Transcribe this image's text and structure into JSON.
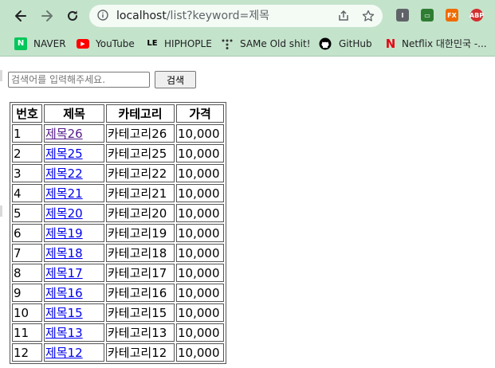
{
  "browser": {
    "url_host": "localhost",
    "url_path": "/list?keyword=제목"
  },
  "bookmarks": [
    {
      "label": "NAVER",
      "icon": "naver-icon",
      "color": "#03c75a"
    },
    {
      "label": "YouTube",
      "icon": "youtube-icon",
      "color": "#ff0000"
    },
    {
      "label": "HIPHOPLE",
      "icon": "hiphople-icon",
      "color": "#000000"
    },
    {
      "label": "SAMe Old shit!",
      "icon": "dots-icon",
      "color": "#333333"
    },
    {
      "label": "GitHub",
      "icon": "github-icon",
      "color": "#000000"
    },
    {
      "label": "Netflix 대한민국 -...",
      "icon": "netflix-icon",
      "color": "#e50914"
    }
  ],
  "search": {
    "placeholder": "검색어를 입력해주세요.",
    "button_label": "검색"
  },
  "table": {
    "headers": [
      "번호",
      "제목",
      "카테고리",
      "가격"
    ],
    "rows": [
      {
        "no": "1",
        "title": "제목26",
        "category": "카테고리26",
        "price": "10,000",
        "visited": true
      },
      {
        "no": "2",
        "title": "제목25",
        "category": "카테고리25",
        "price": "10,000",
        "visited": false
      },
      {
        "no": "3",
        "title": "제목22",
        "category": "카테고리22",
        "price": "10,000",
        "visited": false
      },
      {
        "no": "4",
        "title": "제목21",
        "category": "카테고리21",
        "price": "10,000",
        "visited": false
      },
      {
        "no": "5",
        "title": "제목20",
        "category": "카테고리20",
        "price": "10,000",
        "visited": false
      },
      {
        "no": "6",
        "title": "제목19",
        "category": "카테고리19",
        "price": "10,000",
        "visited": false
      },
      {
        "no": "7",
        "title": "제목18",
        "category": "카테고리18",
        "price": "10,000",
        "visited": false
      },
      {
        "no": "8",
        "title": "제목17",
        "category": "카테고리17",
        "price": "10,000",
        "visited": false
      },
      {
        "no": "9",
        "title": "제목16",
        "category": "카테고리16",
        "price": "10,000",
        "visited": false
      },
      {
        "no": "10",
        "title": "제목15",
        "category": "카테고리15",
        "price": "10,000",
        "visited": false
      },
      {
        "no": "11",
        "title": "제목13",
        "category": "카테고리13",
        "price": "10,000",
        "visited": false
      },
      {
        "no": "12",
        "title": "제목12",
        "category": "카테고리12",
        "price": "10,000",
        "visited": false
      }
    ]
  },
  "colors": {
    "chrome_bg": "#c4e3cb",
    "link": "#0000ee",
    "link_visited": "#551a8b"
  }
}
